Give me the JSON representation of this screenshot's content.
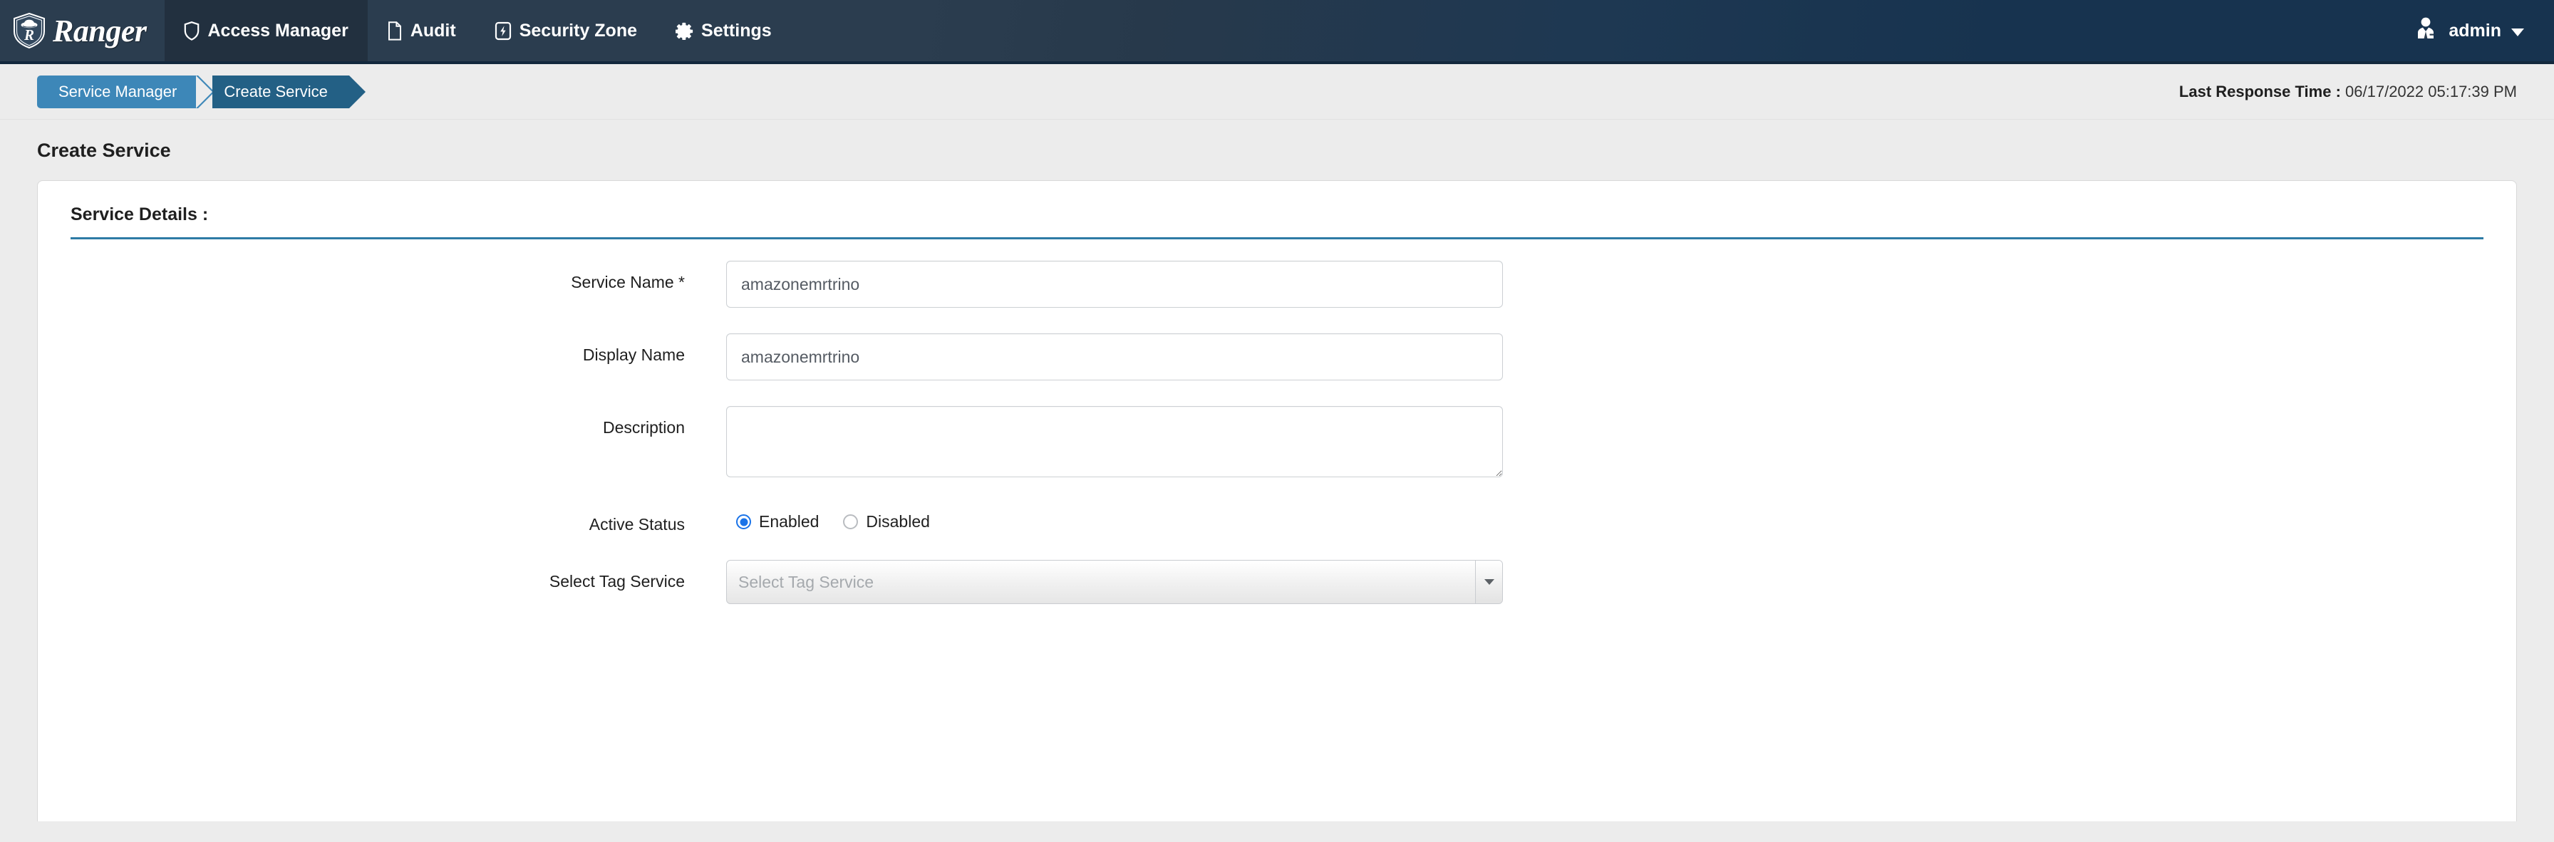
{
  "app": {
    "brand_name": "Ranger",
    "brand_icon": "ranger-shield-logo"
  },
  "nav": {
    "items": [
      {
        "label": "Access Manager",
        "icon": "shield-icon",
        "active": true
      },
      {
        "label": "Audit",
        "icon": "file-icon",
        "active": false
      },
      {
        "label": "Security Zone",
        "icon": "bolt-square-icon",
        "active": false
      },
      {
        "label": "Settings",
        "icon": "gear-icon",
        "active": false
      }
    ],
    "user": {
      "name": "admin",
      "icon": "user-avatar-icon",
      "caret": "chevron-down-icon"
    }
  },
  "breadcrumb": {
    "items": [
      {
        "label": "Service Manager",
        "color": "#3d87b8"
      },
      {
        "label": "Create Service",
        "color": "#236085"
      }
    ]
  },
  "response_time": {
    "label": "Last Response Time :",
    "value": "06/17/2022 05:17:39 PM"
  },
  "page": {
    "title": "Create Service",
    "section_title": "Service Details :"
  },
  "form": {
    "service_name": {
      "label": "Service Name",
      "required_mark": "*",
      "value": "amazonemrtrino",
      "placeholder": "Service Name"
    },
    "display_name": {
      "label": "Display Name",
      "value": "amazonemrtrino",
      "placeholder": "Display Name"
    },
    "description": {
      "label": "Description",
      "value": "",
      "placeholder": ""
    },
    "active_status": {
      "label": "Active Status",
      "options": [
        {
          "label": "Enabled",
          "selected": true
        },
        {
          "label": "Disabled",
          "selected": false
        }
      ]
    },
    "tag_service": {
      "label": "Select Tag Service",
      "value": "",
      "placeholder": "Select Tag Service",
      "arrow_icon": "chevron-down-icon"
    }
  },
  "colors": {
    "navbar": "#2b3d4f",
    "navbar_right": "#17334f",
    "accent": "#2d7ba5",
    "crumb_active": "#236085",
    "radio_selected": "#1a73e8",
    "page_bg": "#ececec"
  }
}
